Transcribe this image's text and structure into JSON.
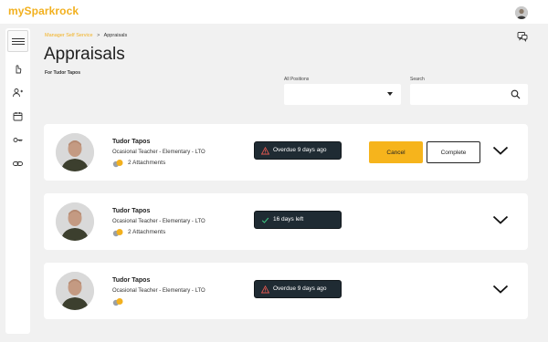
{
  "app": {
    "brand": "mySparkrock"
  },
  "breadcrumb": {
    "parent": "Manager Self Service",
    "separator": ">",
    "current": "Appraisals"
  },
  "page": {
    "title": "Appraisals",
    "subtitle": "For Tudor Tapos"
  },
  "filters": {
    "positions": {
      "label": "All Positions",
      "value": ""
    },
    "search": {
      "label": "Search",
      "value": "",
      "placeholder": ""
    }
  },
  "cards": [
    {
      "name": "Tudor Tapos",
      "position": "Ocasional Teacher - Elementary - LTO",
      "attachments": "2 Attachments",
      "status": "Overdue 9 days ago",
      "status_type": "overdue",
      "actions": {
        "cancel": "Cancel",
        "complete": "Complete"
      }
    },
    {
      "name": "Tudor Tapos",
      "position": "Ocasional Teacher - Elementary - LTO",
      "attachments": "2 Attachments",
      "status": "16 days left",
      "status_type": "ok"
    },
    {
      "name": "Tudor Tapos",
      "position": "Ocasional Teacher - Elementary - LTO",
      "attachments": "",
      "status": "Overdue 9 days ago",
      "status_type": "overdue"
    }
  ],
  "colors": {
    "accent": "#f2b01e",
    "status_bg": "#1f2b33",
    "overdue": "#e0574f",
    "ok": "#3fbf7f"
  },
  "icons": {
    "sidebar": [
      "menu-icon",
      "hand-icon",
      "people-icon",
      "calendar-icon",
      "key-icon",
      "link-icon"
    ],
    "top": [
      "user-avatar",
      "chat-icon"
    ],
    "card": [
      "attachment-icon",
      "warning-icon",
      "check-icon",
      "chevron-down-icon"
    ]
  }
}
